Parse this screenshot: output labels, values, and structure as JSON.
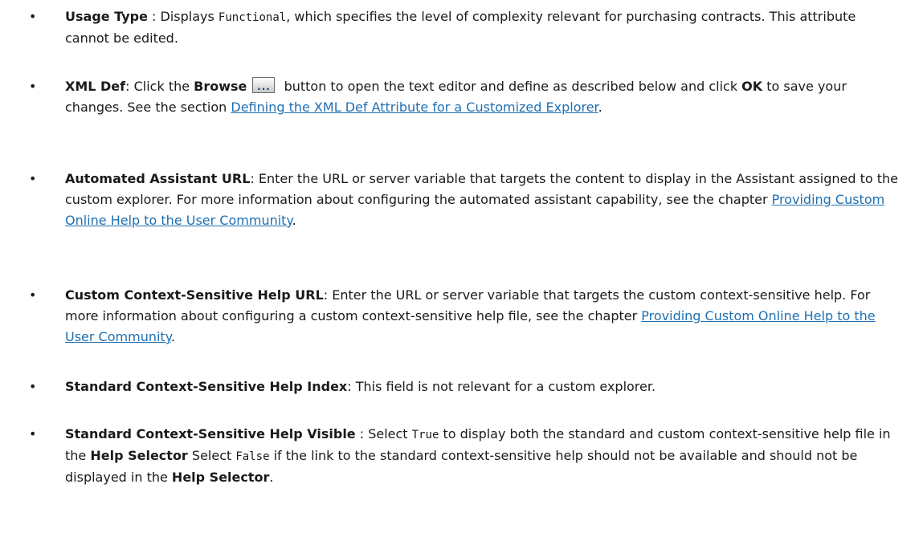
{
  "items": [
    {
      "bullet": "•",
      "term": "Usage Type",
      "sep": " : Displays ",
      "code": "Functional",
      "rest": ", which specifies the level of complexity relevant for purchasing contracts. This attribute cannot be edited."
    },
    {
      "bullet": "•",
      "term": "XML Def",
      "p1": ": Click the ",
      "b1": "Browse",
      "btn_glyph": "...",
      "p2": " button to open the text editor and define as described below and click ",
      "b2": "OK",
      "p3": " to save your changes. See the section ",
      "link": "Defining the XML Def Attribute for a Customized Explorer",
      "end": "."
    },
    {
      "bullet": "•",
      "term": "Automated Assistant URL",
      "p1": ": Enter the URL or server variable that targets the content to display in the Assistant assigned to the custom explorer. For more information about configuring the automated assistant capability, see the chapter ",
      "link": "Providing Custom Online Help to the User Community",
      "end": "."
    },
    {
      "bullet": "•",
      "term": "Custom Context-Sensitive Help URL",
      "p1": ": Enter the URL or server variable that targets the custom context-sensitive help. For more information about configuring a custom context-sensitive help file, see the chapter ",
      "link": "Providing Custom Online Help to the User Community",
      "end": "."
    },
    {
      "bullet": "•",
      "term": "Standard Context-Sensitive Help Index",
      "p1": ": This field is not relevant for a custom explorer."
    },
    {
      "bullet": "•",
      "term": "Standard Context-Sensitive Help Visible",
      "p1": " : Select ",
      "code1": "True",
      "p2": " to display both the standard and custom context-sensitive help file in the ",
      "b1": "Help Selector",
      "p3": " Select ",
      "code2": "False",
      "p4": " if the link to the standard context-sensitive help should not be available and should not be displayed in the ",
      "b2": "Help Selector",
      "end": "."
    }
  ],
  "colors": {
    "link": "#1f6fb2",
    "text": "#1a1a1a"
  }
}
